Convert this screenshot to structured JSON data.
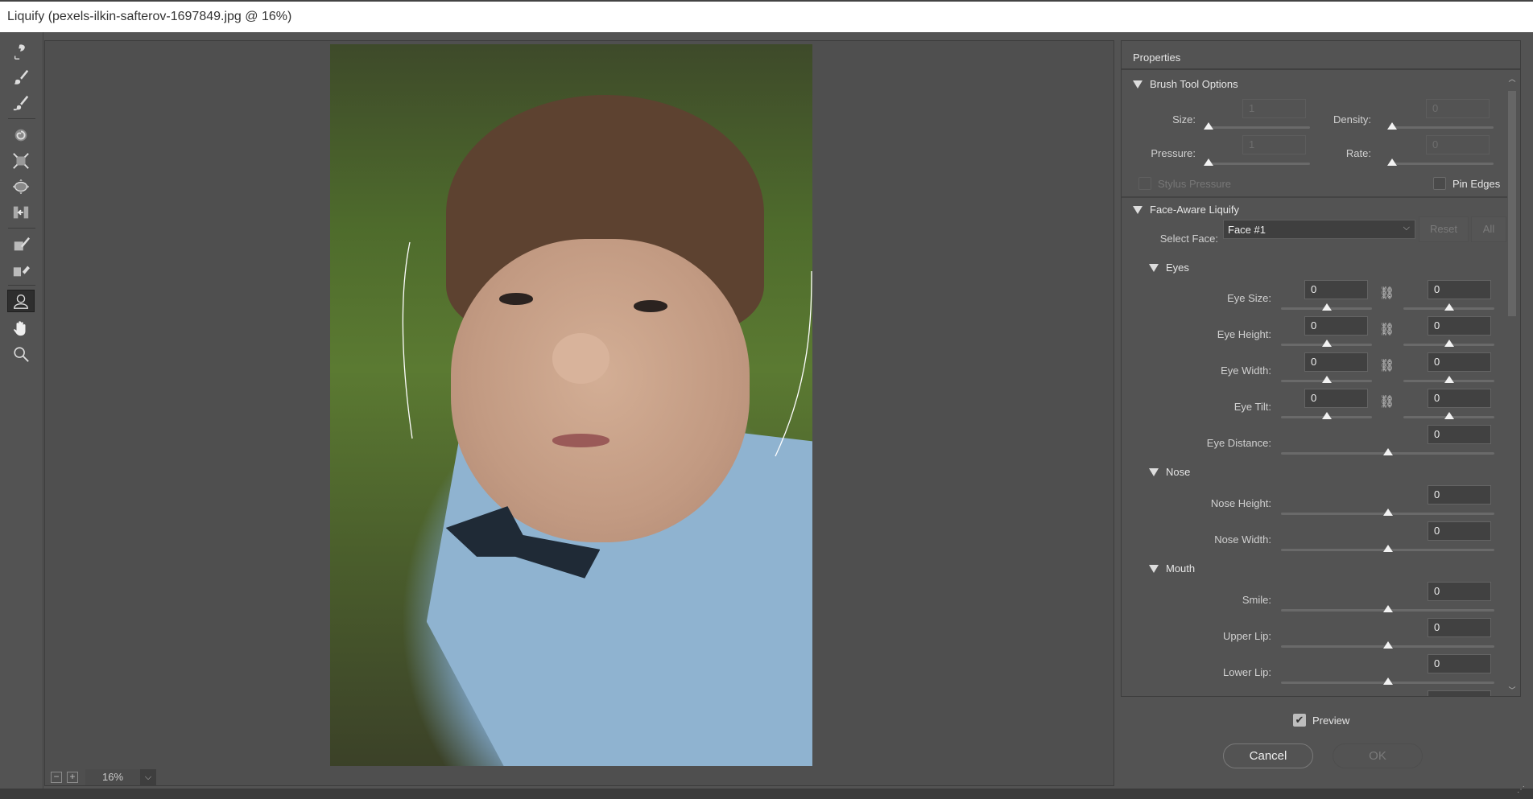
{
  "window": {
    "title": "Liquify (pexels-ilkin-safterov-1697849.jpg @ 16%)"
  },
  "tools": [
    {
      "name": "forward-warp-tool",
      "active": false
    },
    {
      "name": "reconstruct-tool",
      "active": false
    },
    {
      "name": "smooth-tool",
      "active": false
    },
    {
      "name": "twirl-clockwise-tool",
      "active": false
    },
    {
      "name": "pucker-tool",
      "active": false
    },
    {
      "name": "bloat-tool",
      "active": false
    },
    {
      "name": "push-left-tool",
      "active": false
    },
    {
      "name": "freeze-mask-tool",
      "active": false
    },
    {
      "name": "thaw-mask-tool",
      "active": false
    },
    {
      "name": "face-tool",
      "active": true
    },
    {
      "name": "hand-tool",
      "active": false
    },
    {
      "name": "zoom-tool",
      "active": false
    }
  ],
  "canvas": {
    "zoom_value": "16%",
    "zoom_out_label": "−",
    "zoom_in_label": "+",
    "dropdown_icon": "⌵"
  },
  "properties": {
    "title": "Properties",
    "brush": {
      "header": "Brush Tool Options",
      "size_label": "Size:",
      "size_value": "1",
      "density_label": "Density:",
      "density_value": "0",
      "pressure_label": "Pressure:",
      "pressure_value": "1",
      "rate_label": "Rate:",
      "rate_value": "0",
      "stylus_label": "Stylus Pressure",
      "stylus_checked": false,
      "pin_edges_label": "Pin Edges",
      "pin_edges_checked": false
    },
    "face_aware": {
      "header": "Face-Aware Liquify",
      "select_face_label": "Select Face:",
      "select_face_value": "Face #1",
      "reset_label": "Reset",
      "all_label": "All",
      "eyes": {
        "header": "Eyes",
        "rows": [
          {
            "label": "Eye Size:",
            "left": "0",
            "right": "0",
            "linked": true
          },
          {
            "label": "Eye Height:",
            "left": "0",
            "right": "0",
            "linked": true
          },
          {
            "label": "Eye Width:",
            "left": "0",
            "right": "0",
            "linked": true
          },
          {
            "label": "Eye Tilt:",
            "left": "0",
            "right": "0",
            "linked": true
          }
        ],
        "distance_label": "Eye Distance:",
        "distance_value": "0"
      },
      "nose": {
        "header": "Nose",
        "height_label": "Nose Height:",
        "height_value": "0",
        "width_label": "Nose Width:",
        "width_value": "0"
      },
      "mouth": {
        "header": "Mouth",
        "smile_label": "Smile:",
        "smile_value": "0",
        "upper_lip_label": "Upper Lip:",
        "upper_lip_value": "0",
        "lower_lip_label": "Lower Lip:",
        "lower_lip_value": "0"
      }
    }
  },
  "footer": {
    "preview_label": "Preview",
    "preview_checked": true,
    "cancel_label": "Cancel",
    "ok_label": "OK"
  }
}
